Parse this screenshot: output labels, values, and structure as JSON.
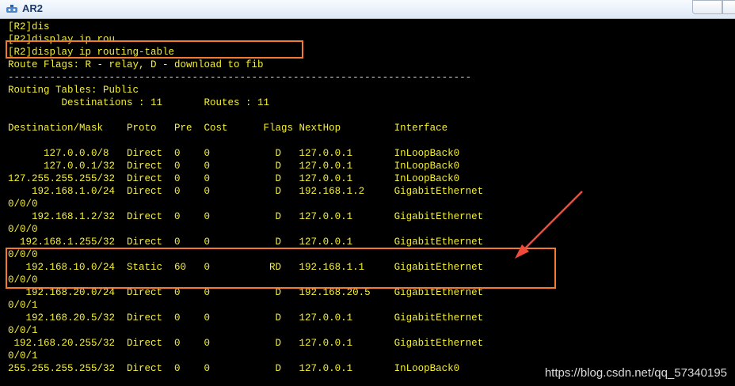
{
  "window": {
    "title": "AR2",
    "title_icon": "router-icon"
  },
  "terminal": {
    "lines": [
      "[R2]dis",
      "[R2]display ip rou",
      "[R2]display ip routing-table",
      "Route Flags: R - relay, D - download to fib",
      "------------------------------------------------------------------------------",
      "Routing Tables: Public",
      "         Destinations : 11       Routes : 11",
      "",
      "Destination/Mask    Proto   Pre  Cost      Flags NextHop         Interface",
      "",
      "      127.0.0.0/8   Direct  0    0           D   127.0.0.1       InLoopBack0",
      "      127.0.0.1/32  Direct  0    0           D   127.0.0.1       InLoopBack0",
      "127.255.255.255/32  Direct  0    0           D   127.0.0.1       InLoopBack0",
      "    192.168.1.0/24  Direct  0    0           D   192.168.1.2     GigabitEthernet",
      "0/0/0",
      "    192.168.1.2/32  Direct  0    0           D   127.0.0.1       GigabitEthernet",
      "0/0/0",
      "  192.168.1.255/32  Direct  0    0           D   127.0.0.1       GigabitEthernet",
      "0/0/0",
      "   192.168.10.0/24  Static  60   0          RD   192.168.1.1     GigabitEthernet",
      "0/0/0",
      "   192.168.20.0/24  Direct  0    0           D   192.168.20.5    GigabitEthernet",
      "0/0/1",
      "   192.168.20.5/32  Direct  0    0           D   127.0.0.1       GigabitEthernet",
      "0/0/1",
      " 192.168.20.255/32  Direct  0    0           D   127.0.0.1       GigabitEthernet",
      "0/0/1",
      "255.255.255.255/32  Direct  0    0           D   127.0.0.1       InLoopBack0"
    ]
  },
  "watermark": "https://blog.csdn.net/qq_57340195",
  "colors": {
    "terminal_background": "#000000",
    "terminal_text": "#f5f033",
    "annotation": "#f47a31",
    "arrow": "#f04a3a",
    "watermark_text": "#dcdcdc"
  }
}
